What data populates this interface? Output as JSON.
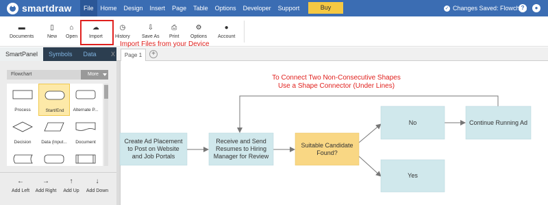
{
  "app": {
    "name": "smartdraw",
    "save_status": "Changes Saved: Flowchart"
  },
  "menu": {
    "items": [
      "File",
      "Home",
      "Design",
      "Insert",
      "Page",
      "Table",
      "Options",
      "Developer",
      "Support"
    ],
    "active": "File",
    "buy_label": "Buy"
  },
  "toolbar": {
    "tools": [
      {
        "label": "Documents",
        "icon": "folder-icon"
      },
      {
        "label": "New",
        "icon": "new-document-icon"
      },
      {
        "label": "Open",
        "icon": "open-folder-icon"
      },
      {
        "label": "Import",
        "icon": "cloud-upload-icon"
      },
      {
        "label": "History",
        "icon": "history-icon"
      },
      {
        "label": "Save As",
        "icon": "save-as-icon"
      },
      {
        "label": "Print",
        "icon": "print-icon"
      },
      {
        "label": "Options",
        "icon": "gears-icon"
      },
      {
        "label": "Account",
        "icon": "user-icon"
      }
    ],
    "import_note": "Import Files from your Device"
  },
  "panel": {
    "tabs": [
      "SmartPanel",
      "Symbols",
      "Data"
    ],
    "active_tab": "SmartPanel",
    "close_label": "X",
    "library": "Flowchart",
    "more_label": "More",
    "shapes": [
      "Process",
      "Start/End",
      "Alternate P...",
      "Decision",
      "Data (Input...",
      "Document",
      "",
      "",
      ""
    ],
    "selected_shape": "Start/End",
    "add_buttons": [
      "Add Left",
      "Add Right",
      "Add Up",
      "Add Down"
    ]
  },
  "page_tabs": {
    "page_label": "Page 1",
    "add_label": "+"
  },
  "diagram": {
    "annotation": [
      "To Connect Two Non-Consecutive Shapes",
      "Use a Shape Connector (Under Lines)"
    ],
    "shapes": {
      "create_ad": "Create Ad Placement to Post on Website and Job Portals",
      "receive": "Receive and Send Resumes to Hiring Manager for Review",
      "suitable": "Suitable Candidate Found?",
      "no": "No",
      "continue": "Continue Running Ad",
      "yes": "Yes"
    },
    "colors": {
      "process_fill": "#d0e8ec",
      "decision_fill": "#f9d784",
      "connector": "#777777",
      "annotation": "#e0201d"
    }
  },
  "colors": {
    "topbar": "#3b6db3",
    "buy_button": "#f5c842",
    "highlight": "#e0201d"
  }
}
